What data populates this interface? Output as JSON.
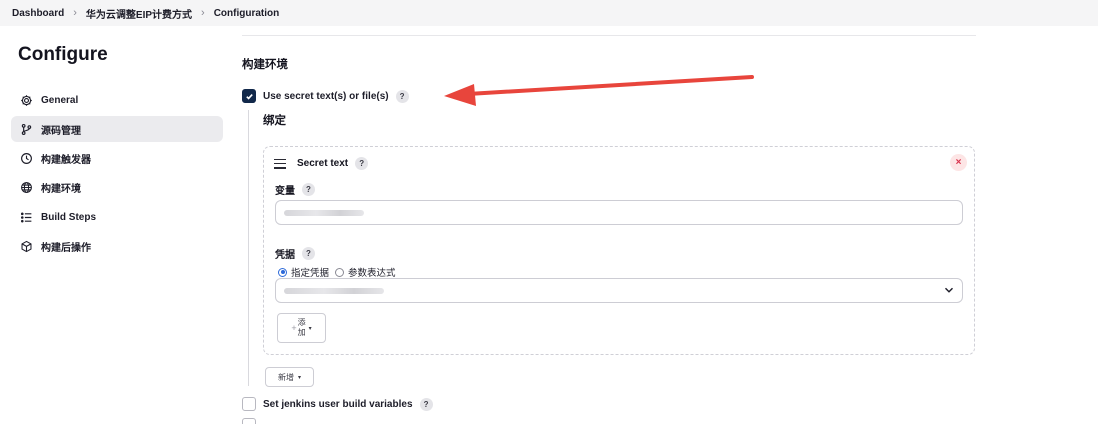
{
  "breadcrumb": {
    "items": [
      "Dashboard",
      "华为云调整EIP计费方式",
      "Configuration"
    ]
  },
  "sidebar": {
    "title": "Configure",
    "items": [
      {
        "label": "General",
        "icon": "gear-icon",
        "active": false
      },
      {
        "label": "源码管理",
        "icon": "branch-icon",
        "active": true
      },
      {
        "label": "构建触发器",
        "icon": "clock-icon",
        "active": false
      },
      {
        "label": "构建环境",
        "icon": "globe-icon",
        "active": false
      },
      {
        "label": "Build Steps",
        "icon": "list-icon",
        "active": false
      },
      {
        "label": "构建后操作",
        "icon": "cube-icon",
        "active": false
      }
    ]
  },
  "main": {
    "section_title": "构建环境",
    "use_secret": {
      "label": "Use secret text(s) or file(s)",
      "checked": true,
      "help": "?"
    },
    "bindings_title": "绑定",
    "secret_card": {
      "title": "Secret text",
      "help": "?",
      "close": "×",
      "variable_label": "变量",
      "variable_help": "?",
      "credentials_label": "凭据",
      "credentials_help": "?",
      "radio_specific": "指定凭据",
      "radio_param": "参数表达式",
      "add_button": {
        "plus": "+",
        "line1": "添",
        "line2": "加",
        "caret": "▾"
      }
    },
    "new_button": {
      "label": "新增",
      "caret": "▾"
    },
    "jenkins_vars": {
      "label": "Set jenkins user build variables",
      "checked": false,
      "help": "?"
    }
  },
  "colors": {
    "accent": "#11284a",
    "arrow": "#e8453c",
    "close_bg": "#fde5e5",
    "close_fg": "#d8304a",
    "radio": "#2f6bd9"
  }
}
